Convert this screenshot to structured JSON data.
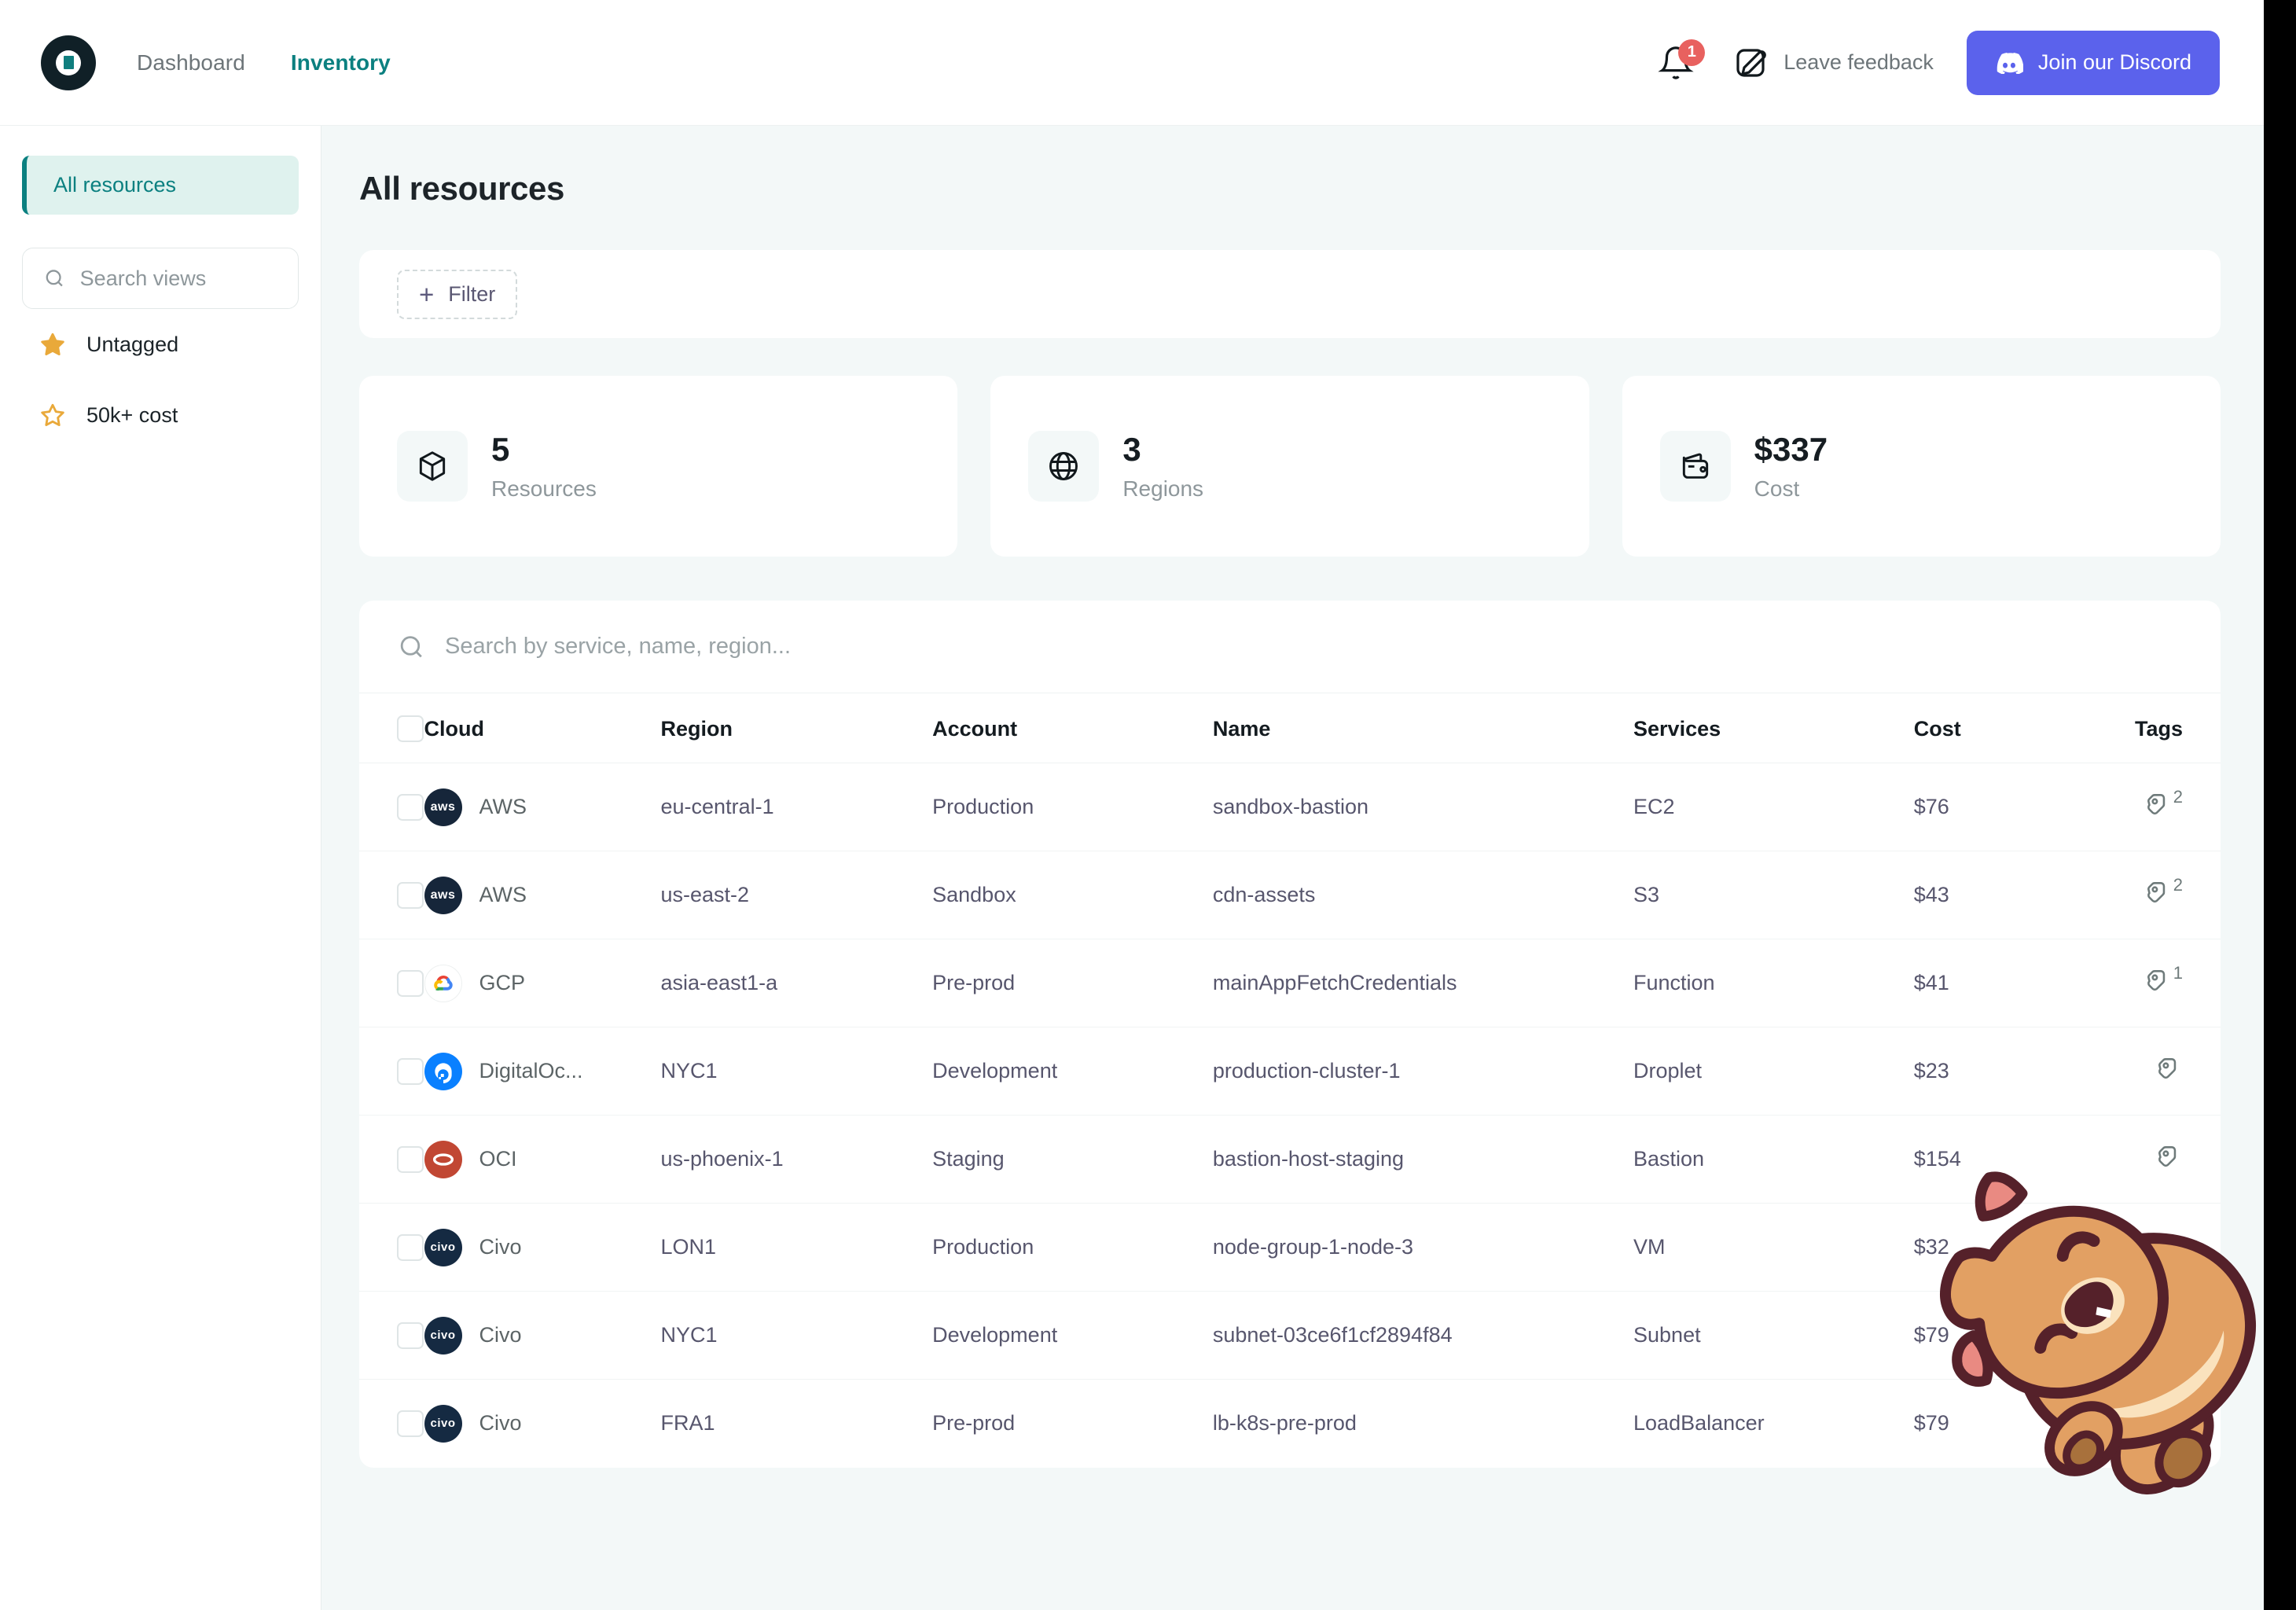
{
  "header": {
    "logo_name": "app-logo",
    "nav": [
      {
        "label": "Dashboard",
        "active": false
      },
      {
        "label": "Inventory",
        "active": true
      }
    ],
    "notifications_count": "1",
    "feedback_label": "Leave feedback",
    "discord_label": "Join our Discord",
    "discord_color": "#5b62ec",
    "badge_color": "#e8615f"
  },
  "sidebar": {
    "active_view": "All resources",
    "search_placeholder": "Search views",
    "search_value": "",
    "views": [
      {
        "label": "Untagged",
        "starred": true
      },
      {
        "label": "50k+ cost",
        "starred": false
      }
    ],
    "star_color": "#e9a93a"
  },
  "main": {
    "page_title": "All resources",
    "filter_label": "Filter",
    "filter_plus": "+",
    "stats": [
      {
        "value": "5",
        "label": "Resources",
        "icon": "cube-icon"
      },
      {
        "value": "3",
        "label": "Regions",
        "icon": "globe-icon"
      },
      {
        "value": "$337",
        "label": "Cost",
        "icon": "wallet-icon"
      }
    ],
    "table": {
      "search_placeholder": "Search by service, name, region...",
      "search_value": "",
      "columns": [
        "Cloud",
        "Region",
        "Account",
        "Name",
        "Services",
        "Cost",
        "Tags"
      ],
      "rows": [
        {
          "cloud": "AWS",
          "logo": "aws",
          "region": "eu-central-1",
          "account": "Production",
          "name": "sandbox-bastion",
          "service": "EC2",
          "cost": "$76",
          "tags": "2"
        },
        {
          "cloud": "AWS",
          "logo": "aws",
          "region": "us-east-2",
          "account": "Sandbox",
          "name": "cdn-assets",
          "service": "S3",
          "cost": "$43",
          "tags": "2"
        },
        {
          "cloud": "GCP",
          "logo": "gcp",
          "region": "asia-east1-a",
          "account": "Pre-prod",
          "name": "mainAppFetchCredentials",
          "service": "Function",
          "cost": "$41",
          "tags": "1"
        },
        {
          "cloud": "DigitalOc...",
          "logo": "do",
          "region": "NYC1",
          "account": "Development",
          "name": "production-cluster-1",
          "service": "Droplet",
          "cost": "$23",
          "tags": ""
        },
        {
          "cloud": "OCI",
          "logo": "oci",
          "region": "us-phoenix-1",
          "account": "Staging",
          "name": "bastion-host-staging",
          "service": "Bastion",
          "cost": "$154",
          "tags": ""
        },
        {
          "cloud": "Civo",
          "logo": "civo",
          "region": "LON1",
          "account": "Production",
          "name": "node-group-1-node-3",
          "service": "VM",
          "cost": "$32",
          "tags": ""
        },
        {
          "cloud": "Civo",
          "logo": "civo",
          "region": "NYC1",
          "account": "Development",
          "name": "subnet-03ce6f1cf2894f84",
          "service": "Subnet",
          "cost": "$79",
          "tags": ""
        },
        {
          "cloud": "Civo",
          "logo": "civo",
          "region": "FRA1",
          "account": "Pre-prod",
          "name": "lb-k8s-pre-prod",
          "service": "LoadBalancer",
          "cost": "$79",
          "tags": ""
        }
      ]
    }
  },
  "mascot": {
    "name": "capybara-mascot"
  }
}
